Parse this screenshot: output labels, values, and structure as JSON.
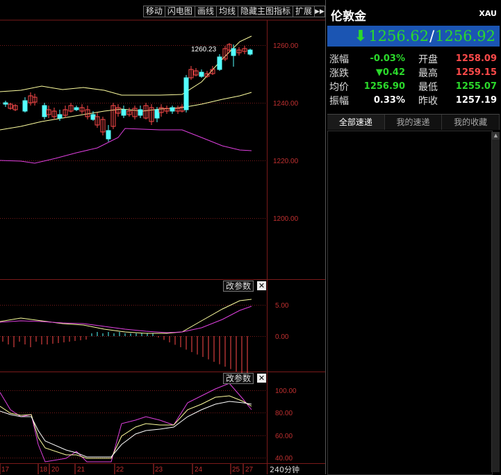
{
  "toolbar": {
    "items": [
      "移动",
      "闪电图",
      "画线",
      "均线",
      "隐藏主图指标",
      "扩展"
    ]
  },
  "axis": {
    "price_ticks": [
      "1260.00",
      "1240.00",
      "1220.00",
      "1200.00"
    ],
    "macd_ticks": [
      "5.00",
      "0.00"
    ],
    "kdj_ticks": [
      "100.00",
      "80.00",
      "60.00",
      "40.00"
    ],
    "dates": [
      "17",
      "18",
      "20",
      "21",
      "22",
      "23",
      "24",
      "25",
      "27"
    ],
    "period": "240分钟"
  },
  "annotation": {
    "high_label": "1260.23"
  },
  "panels": {
    "param_label": "改参数",
    "close_glyph": "✕"
  },
  "side": {
    "title": "伦敦金",
    "code": "XAU",
    "price_bid": "1256.62",
    "price_ask": "1256.92",
    "price_sep": "/",
    "stats": [
      {
        "l1": "涨幅",
        "v1": "-0.03%",
        "c1": "green",
        "l2": "开盘",
        "v2": "1258.09",
        "c2": "red"
      },
      {
        "l1": "涨跌",
        "v1": "▼0.42",
        "c1": "green",
        "l2": "最高",
        "v2": "1259.15",
        "c2": "red"
      },
      {
        "l1": "均价",
        "v1": "1256.90",
        "c1": "green",
        "l2": "最低",
        "v2": "1255.07",
        "c2": "green"
      },
      {
        "l1": "振幅",
        "v1": "0.33%",
        "c1": "white",
        "l2": "昨收",
        "v2": "1257.19",
        "c2": "white"
      }
    ],
    "tabs": [
      "全部速递",
      "我的速递",
      "我的收藏"
    ]
  },
  "colors": {
    "up": "#ff4a4a",
    "down": "#54ffff",
    "ma": "#ffffa0",
    "band_low": "#e040e0",
    "grid": "#7a1a1a",
    "axis_text": "#c03030"
  }
}
